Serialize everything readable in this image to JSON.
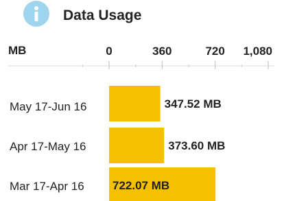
{
  "header": {
    "icon": "info-icon",
    "title": "Data Usage"
  },
  "chart_data": {
    "type": "bar",
    "orientation": "horizontal",
    "unit_label": "MB",
    "categories": [
      "May 17-Jun 16",
      "Apr 17-May 16",
      "Mar 17-Apr 16"
    ],
    "values": [
      347.52,
      373.6,
      722.07
    ],
    "value_labels": [
      "347.52 MB",
      "373.60 MB",
      "722.07 MB"
    ],
    "x_ticks": [
      0,
      360,
      720,
      1080
    ],
    "x_tick_labels": [
      "0",
      "360",
      "720",
      "1,080"
    ],
    "xlim": [
      0,
      1080
    ],
    "bar_color": "#f5c000",
    "grid": false
  }
}
